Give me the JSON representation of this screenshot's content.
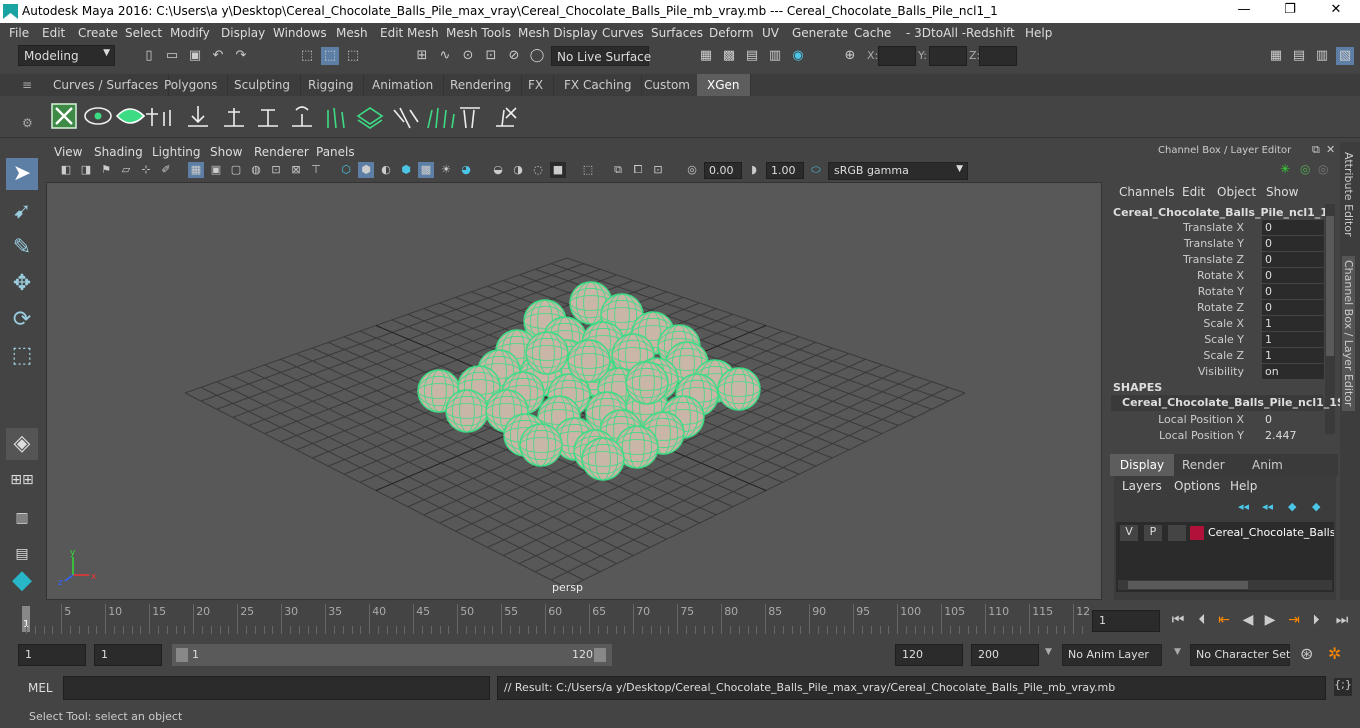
{
  "window": {
    "title": "Autodesk Maya 2016: C:\\Users\\a y\\Desktop\\Cereal_Chocolate_Balls_Pile_max_vray\\Cereal_Chocolate_Balls_Pile_mb_vray.mb  ---  Cereal_Chocolate_Balls_Pile_ncl1_1",
    "minimize": "—",
    "maximize": "❐",
    "close": "✕"
  },
  "menu": [
    "File",
    "Edit",
    "Create",
    "Select",
    "Modify",
    "Display",
    "Windows",
    "Mesh",
    "Edit Mesh",
    "Mesh Tools",
    "Mesh Display",
    "Curves",
    "Surfaces",
    "Deform",
    "UV",
    "Generate",
    "Cache",
    "- 3DtoAll -",
    "Redshift",
    "Help"
  ],
  "status": {
    "mode": "Modeling",
    "live_surface": "No Live Surface",
    "x_label": "X:",
    "y_label": "Y:",
    "z_label": "Z:"
  },
  "shelf_tabs": [
    "Curves / Surfaces",
    "Polygons",
    "Sculpting",
    "Rigging",
    "Animation",
    "Rendering",
    "FX",
    "FX Caching",
    "Custom",
    "XGen"
  ],
  "active_shelf_tab": "XGen",
  "panel_menu": [
    "View",
    "Shading",
    "Lighting",
    "Show",
    "Renderer",
    "Panels"
  ],
  "panel_toolbar": {
    "exposure": "0.00",
    "gamma": "1.00",
    "color_space": "sRGB gamma"
  },
  "viewport": {
    "camera": "persp",
    "axis_x": "x",
    "axis_y": "y",
    "axis_z": "z"
  },
  "channel_box": {
    "header": "Channel Box / Layer Editor",
    "menu": [
      "Channels",
      "Edit",
      "Object",
      "Show"
    ],
    "object_name": "Cereal_Chocolate_Balls_Pile_ncl1_1",
    "channels": [
      {
        "label": "Translate X",
        "value": "0"
      },
      {
        "label": "Translate Y",
        "value": "0"
      },
      {
        "label": "Translate Z",
        "value": "0"
      },
      {
        "label": "Rotate X",
        "value": "0"
      },
      {
        "label": "Rotate Y",
        "value": "0"
      },
      {
        "label": "Rotate Z",
        "value": "0"
      },
      {
        "label": "Scale X",
        "value": "1"
      },
      {
        "label": "Scale Y",
        "value": "1"
      },
      {
        "label": "Scale Z",
        "value": "1"
      },
      {
        "label": "Visibility",
        "value": "on"
      }
    ],
    "shapes_header": "SHAPES",
    "shape_name": "Cereal_Chocolate_Balls_Pile_ncl1_1S...",
    "shape_channels": [
      {
        "label": "Local Position X",
        "value": "0"
      },
      {
        "label": "Local Position Y",
        "value": "2.447"
      }
    ]
  },
  "layer_editor": {
    "tabs": [
      "Display",
      "Render",
      "Anim"
    ],
    "active_tab": "Display",
    "menu": [
      "Layers",
      "Options",
      "Help"
    ],
    "layer": {
      "v": "V",
      "p": "P",
      "name": "Cereal_Chocolate_Balls_P",
      "color": "#b0123a"
    }
  },
  "side_tabs": [
    "Attribute Editor",
    "Channel Box / Layer Editor"
  ],
  "timeline": {
    "ticks": [
      "5",
      "10",
      "15",
      "20",
      "25",
      "30",
      "35",
      "40",
      "45",
      "50",
      "55",
      "60",
      "65",
      "70",
      "75",
      "80",
      "85",
      "90",
      "95",
      "100",
      "105",
      "110",
      "115",
      "12"
    ],
    "current_frame_field": "1",
    "current_frame_marker": "1"
  },
  "range": {
    "start": "1",
    "playback_start": "1",
    "slider_start": "1",
    "slider_end": "120",
    "playback_end": "120",
    "end": "200",
    "anim_layer": "No Anim Layer",
    "character_set": "No Character Set"
  },
  "command": {
    "label": "MEL",
    "result": "// Result: C:/Users/a y/Desktop/Cereal_Chocolate_Balls_Pile_max_vray/Cereal_Chocolate_Balls_Pile_mb_vray.mb"
  },
  "help_line": "Select Tool: select an object",
  "colors": {
    "wire": "#3ddc84",
    "accent": "#5d5d5d",
    "layer": "#b0123a"
  }
}
